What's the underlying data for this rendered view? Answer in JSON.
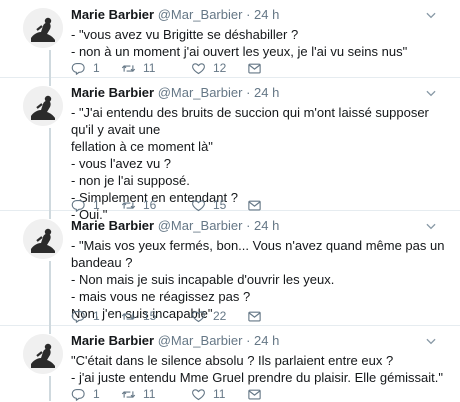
{
  "user": {
    "name": "Marie Barbier",
    "handle": "@Mar_Barbier",
    "separator": "·",
    "time": "24 h"
  },
  "icons": {
    "reply": "reply-icon",
    "retweet": "retweet-icon",
    "like": "heart-icon",
    "dm": "envelope-icon",
    "caret": "chevron-down-icon"
  },
  "colors": {
    "meta": "#657786",
    "rail": "#cfd9de",
    "divider": "#e6ecf0"
  },
  "tweets": [
    {
      "text": "- \"vous avez vu Brigitte se déshabiller ?\n- non à un moment j'ai ouvert les yeux, je l'ai vu seins nus\"",
      "replies": "1",
      "retweets": "11",
      "likes": "12"
    },
    {
      "text": "- \"J'ai entendu des bruits de succion qui m'ont laissé supposer qu'il y avait une\nfellation à ce moment là\"\n- vous l'avez vu ?\n- non je l'ai supposé.\n- Simplement en entendant ?\n- Oui.\"",
      "replies": "1",
      "retweets": "16",
      "likes": "15"
    },
    {
      "text": "- \"Mais vos yeux fermés, bon... Vous n'avez quand même pas un bandeau ?\n- Non mais je suis incapable d'ouvrir les yeux.\n- mais vous ne réagissez pas ?\nNon, j'en suis incapable\"",
      "replies": "1",
      "retweets": "15",
      "likes": "22"
    },
    {
      "text": "\"C'était dans le silence absolu ? Ils parlaient entre eux ?\n- j'ai juste entendu Mme Gruel prendre du plaisir. Elle gémissait.\"",
      "replies": "1",
      "retweets": "11",
      "likes": "11"
    }
  ]
}
